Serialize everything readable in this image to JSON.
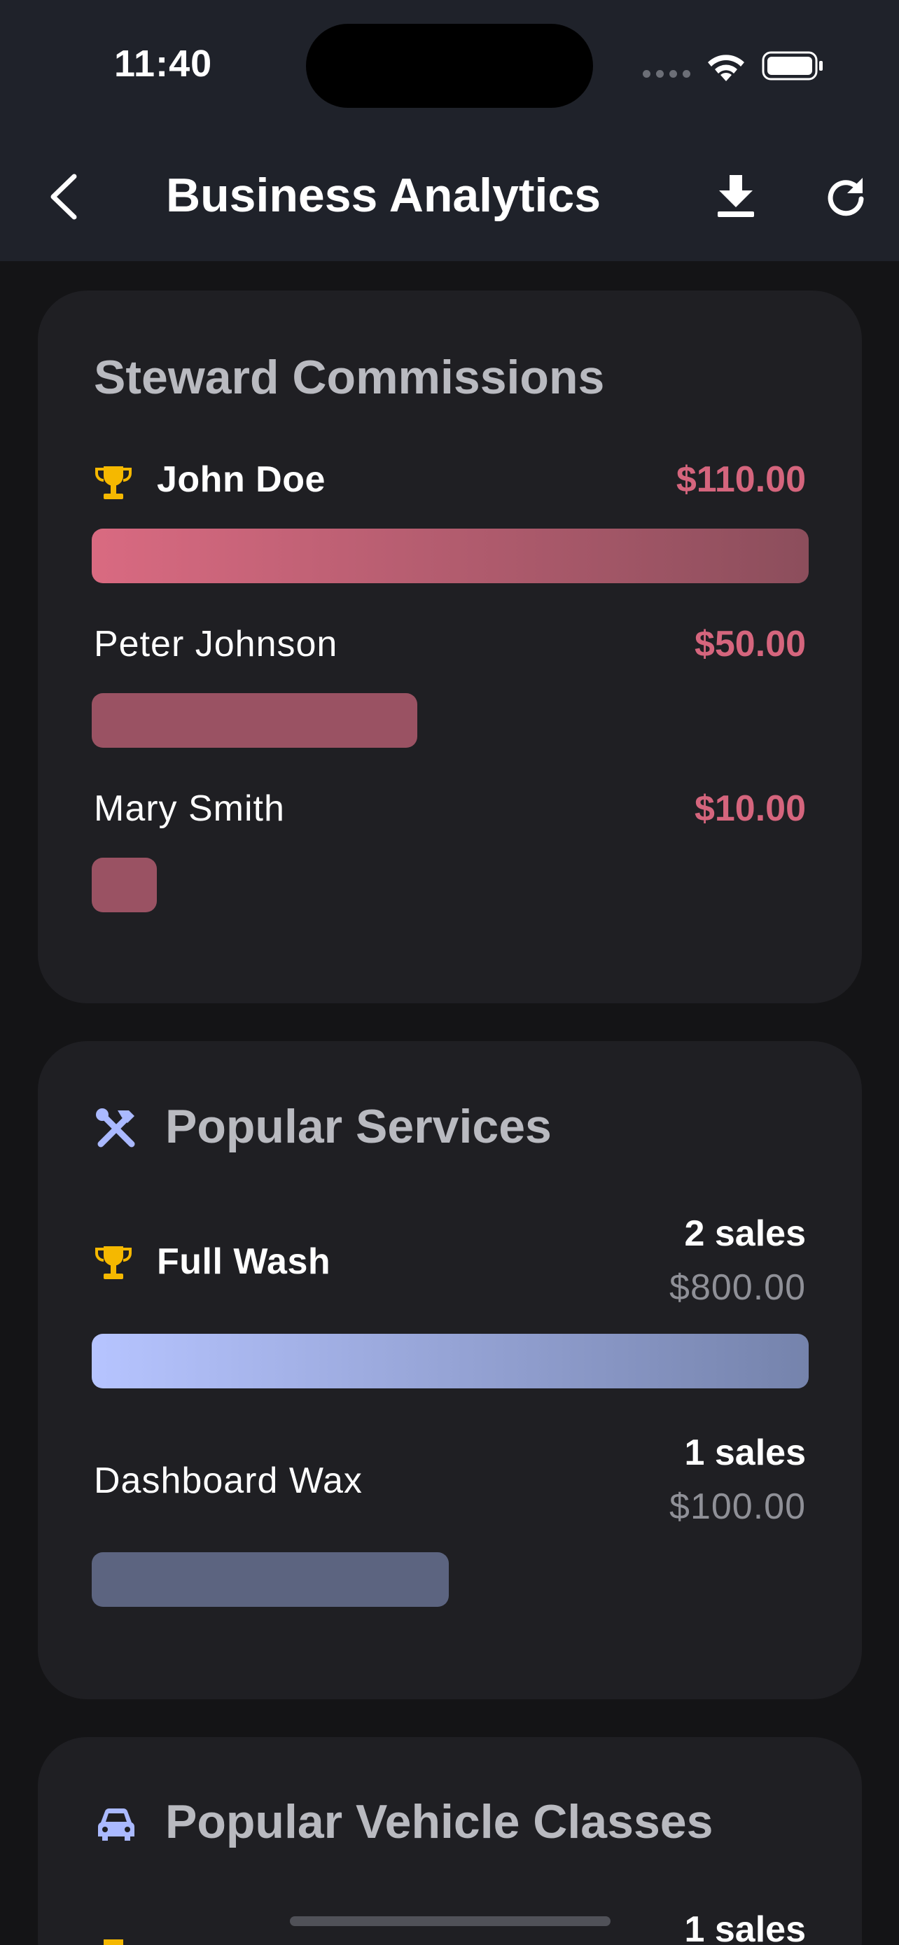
{
  "status_bar": {
    "time": "11:40"
  },
  "header": {
    "title": "Business Analytics",
    "back_icon": "chevron-left-icon",
    "download_icon": "download-icon",
    "refresh_icon": "refresh-icon"
  },
  "commissions": {
    "title": "Steward Commissions",
    "items": [
      {
        "name": "John Doe",
        "amount": "$110.00",
        "value": 110,
        "top": true
      },
      {
        "name": "Peter Johnson",
        "amount": "$50.00",
        "value": 50,
        "top": false
      },
      {
        "name": "Mary Smith",
        "amount": "$10.00",
        "value": 10,
        "top": false
      }
    ]
  },
  "services": {
    "title": "Popular Services",
    "icon": "tools-icon",
    "items": [
      {
        "name": "Full Wash",
        "sales": "2 sales",
        "revenue": "$800.00",
        "count": 2,
        "top": true
      },
      {
        "name": "Dashboard Wax",
        "sales": "1 sales",
        "revenue": "$100.00",
        "count": 1,
        "top": false
      }
    ]
  },
  "vehicle_classes": {
    "title": "Popular Vehicle Classes",
    "icon": "car-icon",
    "items": [
      {
        "sales": "1 sales"
      }
    ]
  },
  "colors": {
    "header_bg": "#1f222a",
    "card_bg": "#1f1f23",
    "commission_amount": "#d5657d",
    "trophy": "#f5b800",
    "service_accent": "#aab9ff"
  }
}
